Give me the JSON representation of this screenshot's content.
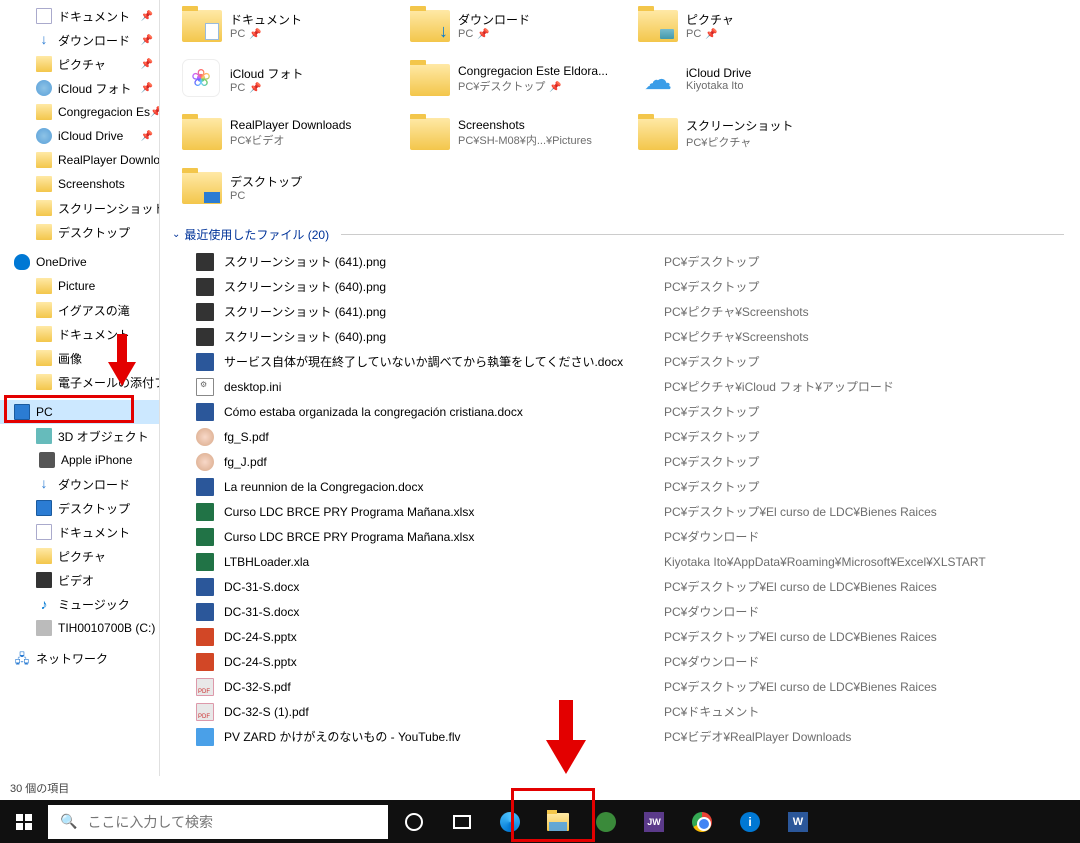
{
  "sidebar": [
    {
      "icon": "doc",
      "label": "ドキュメント",
      "pin": true,
      "indent": "sub"
    },
    {
      "icon": "dl",
      "label": "ダウンロード",
      "pin": true,
      "indent": "sub"
    },
    {
      "icon": "pic",
      "label": "ピクチャ",
      "pin": true,
      "indent": "sub"
    },
    {
      "icon": "cloud",
      "label": "iCloud フォト",
      "pin": true,
      "indent": "sub"
    },
    {
      "icon": "folder",
      "label": "Congregacion Es",
      "pin": true,
      "indent": "sub"
    },
    {
      "icon": "cloud",
      "label": "iCloud Drive",
      "pin": true,
      "indent": "sub"
    },
    {
      "icon": "folder",
      "label": "RealPlayer Downloa",
      "pin": false,
      "indent": "sub"
    },
    {
      "icon": "folder",
      "label": "Screenshots",
      "pin": false,
      "indent": "sub"
    },
    {
      "icon": "folder",
      "label": "スクリーンショット",
      "pin": false,
      "indent": "sub"
    },
    {
      "icon": "folder",
      "label": "デスクトップ",
      "pin": false,
      "indent": "sub"
    },
    {
      "spacer": true
    },
    {
      "icon": "onedrive",
      "label": "OneDrive",
      "indent": "root"
    },
    {
      "icon": "folder",
      "label": "Picture",
      "indent": "sub"
    },
    {
      "icon": "folder",
      "label": "イグアスの滝",
      "indent": "sub"
    },
    {
      "icon": "folder",
      "label": "ドキュメント",
      "indent": "sub"
    },
    {
      "icon": "folder",
      "label": "画像",
      "indent": "sub"
    },
    {
      "icon": "folder",
      "label": "電子メールの添付ファ",
      "indent": "sub"
    },
    {
      "spacer": true
    },
    {
      "icon": "pc",
      "label": "PC",
      "indent": "root",
      "highlight": true
    },
    {
      "icon": "3d",
      "label": "3D オブジェクト",
      "indent": "sub"
    },
    {
      "icon": "phone",
      "label": "Apple iPhone",
      "indent": "sub"
    },
    {
      "icon": "dl",
      "label": "ダウンロード",
      "indent": "sub"
    },
    {
      "icon": "desk",
      "label": "デスクトップ",
      "indent": "sub"
    },
    {
      "icon": "doc",
      "label": "ドキュメント",
      "indent": "sub"
    },
    {
      "icon": "pic",
      "label": "ピクチャ",
      "indent": "sub"
    },
    {
      "icon": "video",
      "label": "ビデオ",
      "indent": "sub"
    },
    {
      "icon": "music",
      "label": "ミュージック",
      "indent": "sub"
    },
    {
      "icon": "drive",
      "label": "TIH0010700B (C:)",
      "indent": "sub"
    },
    {
      "spacer": true
    },
    {
      "icon": "net",
      "label": "ネットワーク",
      "indent": "root"
    }
  ],
  "folders": [
    {
      "name": "ドキュメント",
      "path": "PC",
      "pin": true,
      "icon": "doc"
    },
    {
      "name": "ダウンロード",
      "path": "PC",
      "pin": true,
      "icon": "dl"
    },
    {
      "name": "ピクチャ",
      "path": "PC",
      "pin": true,
      "icon": "pic"
    },
    {
      "name": "iCloud フォト",
      "path": "PC",
      "pin": true,
      "icon": "icloudphotos"
    },
    {
      "name": "Congregacion Este Eldora...",
      "path": "PC¥デスクトップ",
      "pin": true,
      "icon": "folder"
    },
    {
      "name": "iCloud Drive",
      "path": "Kiyotaka Ito",
      "pin": false,
      "icon": "iclouddrive"
    },
    {
      "name": "RealPlayer Downloads",
      "path": "PC¥ビデオ",
      "pin": false,
      "icon": "folder"
    },
    {
      "name": "Screenshots",
      "path": "PC¥SH-M08¥内...¥Pictures",
      "pin": false,
      "icon": "folder"
    },
    {
      "name": "スクリーンショット",
      "path": "PC¥ピクチャ",
      "pin": false,
      "icon": "folder"
    },
    {
      "name": "デスクトップ",
      "path": "PC",
      "pin": false,
      "icon": "desk"
    }
  ],
  "section_header": "最近使用したファイル (20)",
  "recent": [
    {
      "icon": "png",
      "name": "スクリーンショット (641).png",
      "path": "PC¥デスクトップ"
    },
    {
      "icon": "png",
      "name": "スクリーンショット (640).png",
      "path": "PC¥デスクトップ"
    },
    {
      "icon": "png",
      "name": "スクリーンショット (641).png",
      "path": "PC¥ピクチャ¥Screenshots"
    },
    {
      "icon": "png",
      "name": "スクリーンショット (640).png",
      "path": "PC¥ピクチャ¥Screenshots"
    },
    {
      "icon": "word",
      "name": "サービス自体が現在終了していないか調べてから執筆をしてください.docx",
      "path": "PC¥デスクトップ"
    },
    {
      "icon": "ini",
      "name": "desktop.ini",
      "path": "PC¥ピクチャ¥iCloud フォト¥アップロード"
    },
    {
      "icon": "word",
      "name": "Cómo estaba organizada la congregación cristiana.docx",
      "path": "PC¥デスクトップ"
    },
    {
      "icon": "face",
      "name": "fg_S.pdf",
      "path": "PC¥デスクトップ"
    },
    {
      "icon": "face",
      "name": "fg_J.pdf",
      "path": "PC¥デスクトップ"
    },
    {
      "icon": "word",
      "name": "La reunnion de la Congregacion.docx",
      "path": "PC¥デスクトップ"
    },
    {
      "icon": "excel",
      "name": "Curso  LDC   BRCE   PRY Programa Mañana.xlsx",
      "path": "PC¥デスクトップ¥El curso de LDC¥Bienes Raices"
    },
    {
      "icon": "excel",
      "name": "Curso  LDC   BRCE   PRY Programa Mañana.xlsx",
      "path": "PC¥ダウンロード"
    },
    {
      "icon": "excel",
      "name": "LTBHLoader.xla",
      "path": "Kiyotaka Ito¥AppData¥Roaming¥Microsoft¥Excel¥XLSTART"
    },
    {
      "icon": "word",
      "name": "DC-31-S.docx",
      "path": "PC¥デスクトップ¥El curso de LDC¥Bienes Raices"
    },
    {
      "icon": "word",
      "name": "DC-31-S.docx",
      "path": "PC¥ダウンロード"
    },
    {
      "icon": "ppt",
      "name": "DC-24-S.pptx",
      "path": "PC¥デスクトップ¥El curso de LDC¥Bienes Raices"
    },
    {
      "icon": "ppt",
      "name": "DC-24-S.pptx",
      "path": "PC¥ダウンロード"
    },
    {
      "icon": "pdf",
      "name": "DC-32-S.pdf",
      "path": "PC¥デスクトップ¥El curso de LDC¥Bienes Raices"
    },
    {
      "icon": "pdf",
      "name": "DC-32-S (1).pdf",
      "path": "PC¥ドキュメント"
    },
    {
      "icon": "flv",
      "name": "PV ZARD かけがえのないもの - YouTube.flv",
      "path": "PC¥ビデオ¥RealPlayer Downloads"
    }
  ],
  "statusbar": "30 個の項目",
  "search_placeholder": "ここに入力して検索",
  "taskbar_icons": [
    "cortana",
    "taskview",
    "edge",
    "explorer",
    "green",
    "jw",
    "chrome",
    "info",
    "word"
  ]
}
